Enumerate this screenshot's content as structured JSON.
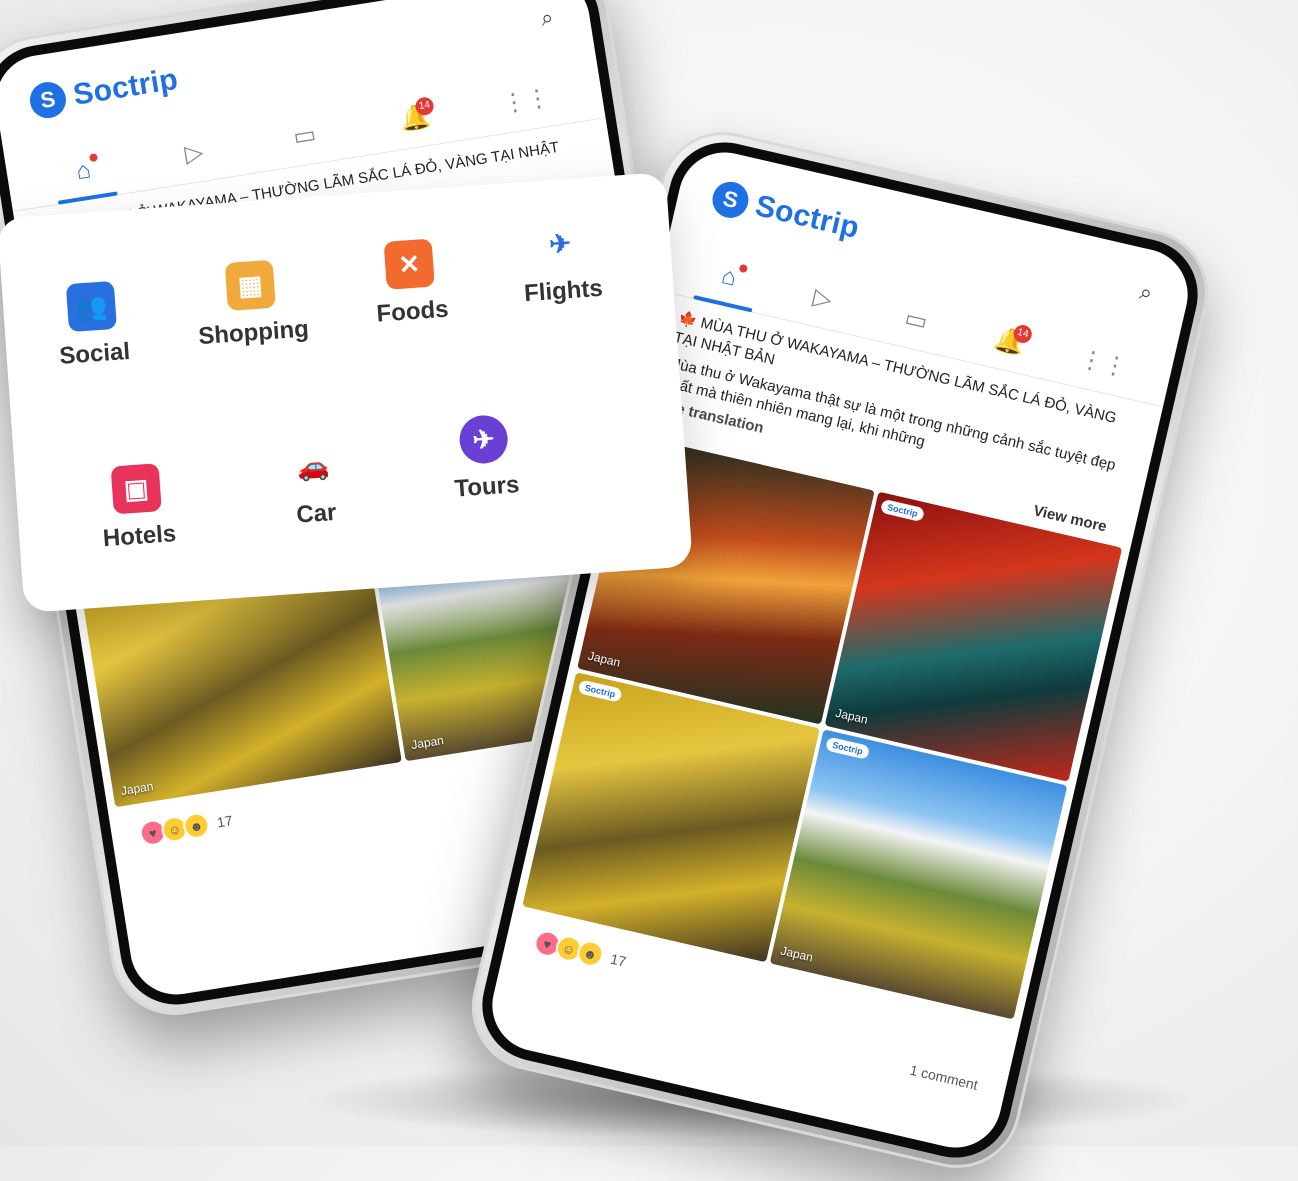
{
  "app": {
    "name": "Soctrip",
    "logo_letter": "S"
  },
  "tabs": [
    {
      "name": "home",
      "icon": "⌂"
    },
    {
      "name": "video",
      "icon": "▷"
    },
    {
      "name": "calendar",
      "icon": "▭"
    },
    {
      "name": "notifications",
      "icon": "🔔",
      "badge": "14"
    },
    {
      "name": "apps",
      "icon": "⋮⋮"
    }
  ],
  "post": {
    "title": "🍁 MÙA THU Ở WAKAYAMA – THƯỜNG LÃM SẮC LÁ ĐỎ, VÀNG TẠI NHẬT BẢN",
    "body": "Mùa thu ở Wakayama thật sự là một trong những cảnh sắc tuyệt đẹp nhất mà thiên nhiên mang lại, khi những",
    "see_translation": "See translation",
    "view_more": "View more",
    "photo_tag": "Soctrip",
    "photo_location": "Japan",
    "reaction_count": "17",
    "comments": "1 comment"
  },
  "services": {
    "social": "Social",
    "shopping": "Shopping",
    "foods": "Foods",
    "flights": "Flights",
    "hotels": "Hotels",
    "car": "Car",
    "tours": "Tours"
  },
  "colors": {
    "brand": "#1f6fe5",
    "badge": "#e53935"
  }
}
